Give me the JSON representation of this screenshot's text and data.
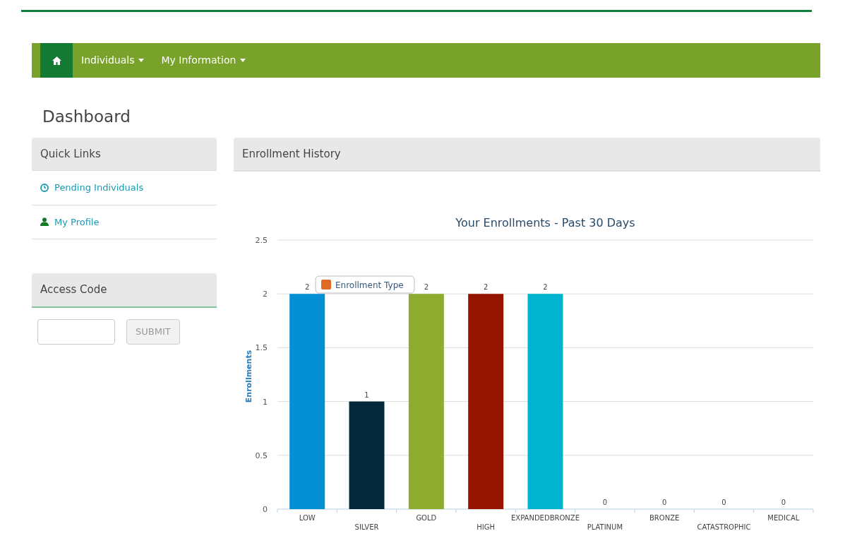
{
  "navbar": {
    "items": [
      {
        "kind": "home",
        "selected": true
      },
      {
        "kind": "dropdown",
        "label": "Individuals",
        "selected": false
      },
      {
        "kind": "dropdown",
        "label": "My Information",
        "selected": false
      }
    ]
  },
  "page_title": "Dashboard",
  "quick_links": {
    "title": "Quick Links",
    "items": [
      {
        "kind": "clock",
        "label": "Pending Individuals"
      },
      {
        "kind": "person",
        "label": "My Profile"
      }
    ]
  },
  "access_code": {
    "title": "Access Code",
    "button": "SUBMIT"
  },
  "enrollment_history": {
    "title": "Enrollment History",
    "chart_data": {
      "type": "bar",
      "title": "Your Enrollments - Past 30 Days",
      "ylabel": "Enrollments",
      "categories": [
        "LOW",
        "SILVER",
        "GOLD",
        "HIGH",
        "EXPANDEDBRONZE",
        "PLATINUM",
        "BRONZE",
        "CATASTROPHIC",
        "MEDICAL"
      ],
      "series": [
        {
          "name": "Enrollment Type",
          "color": "#e06a25",
          "values": [
            2,
            1,
            2,
            2,
            2,
            0,
            0,
            0,
            0
          ],
          "colors": [
            "#0590d5",
            "#05283a",
            "#8fab30",
            "#951400",
            "#00b3cf",
            null,
            null,
            null,
            null
          ]
        }
      ],
      "grid": true,
      "ylim": [
        0,
        2.5
      ],
      "yticks": [
        0,
        0.5,
        1,
        1.5,
        2,
        2.5
      ],
      "data_labels": true
    }
  }
}
